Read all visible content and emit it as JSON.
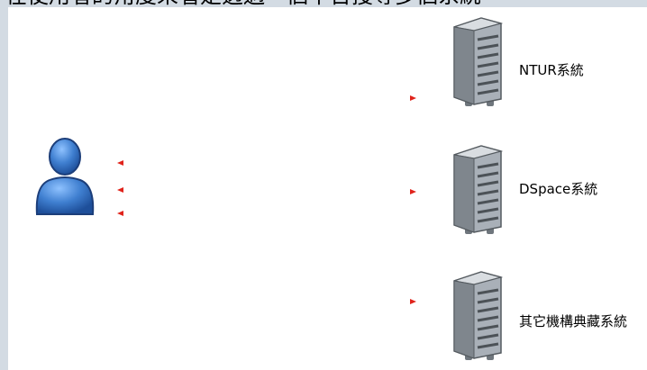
{
  "header": {
    "cut_text": "在使用者的角度來看是透過一個平台搜尋多個系統"
  },
  "servers": [
    {
      "label": "NTUR系統"
    },
    {
      "label": "DSpace系統"
    },
    {
      "label": "其它機構典藏系統"
    }
  ],
  "colors": {
    "arrow": "#e0231b",
    "user_body": "#3f7fd0",
    "server_body": "#a9b0b8",
    "background": "#d3dbe3"
  },
  "icons": {
    "user": "user-icon",
    "server": "server-icon",
    "arrow": "arrowhead-icon"
  }
}
